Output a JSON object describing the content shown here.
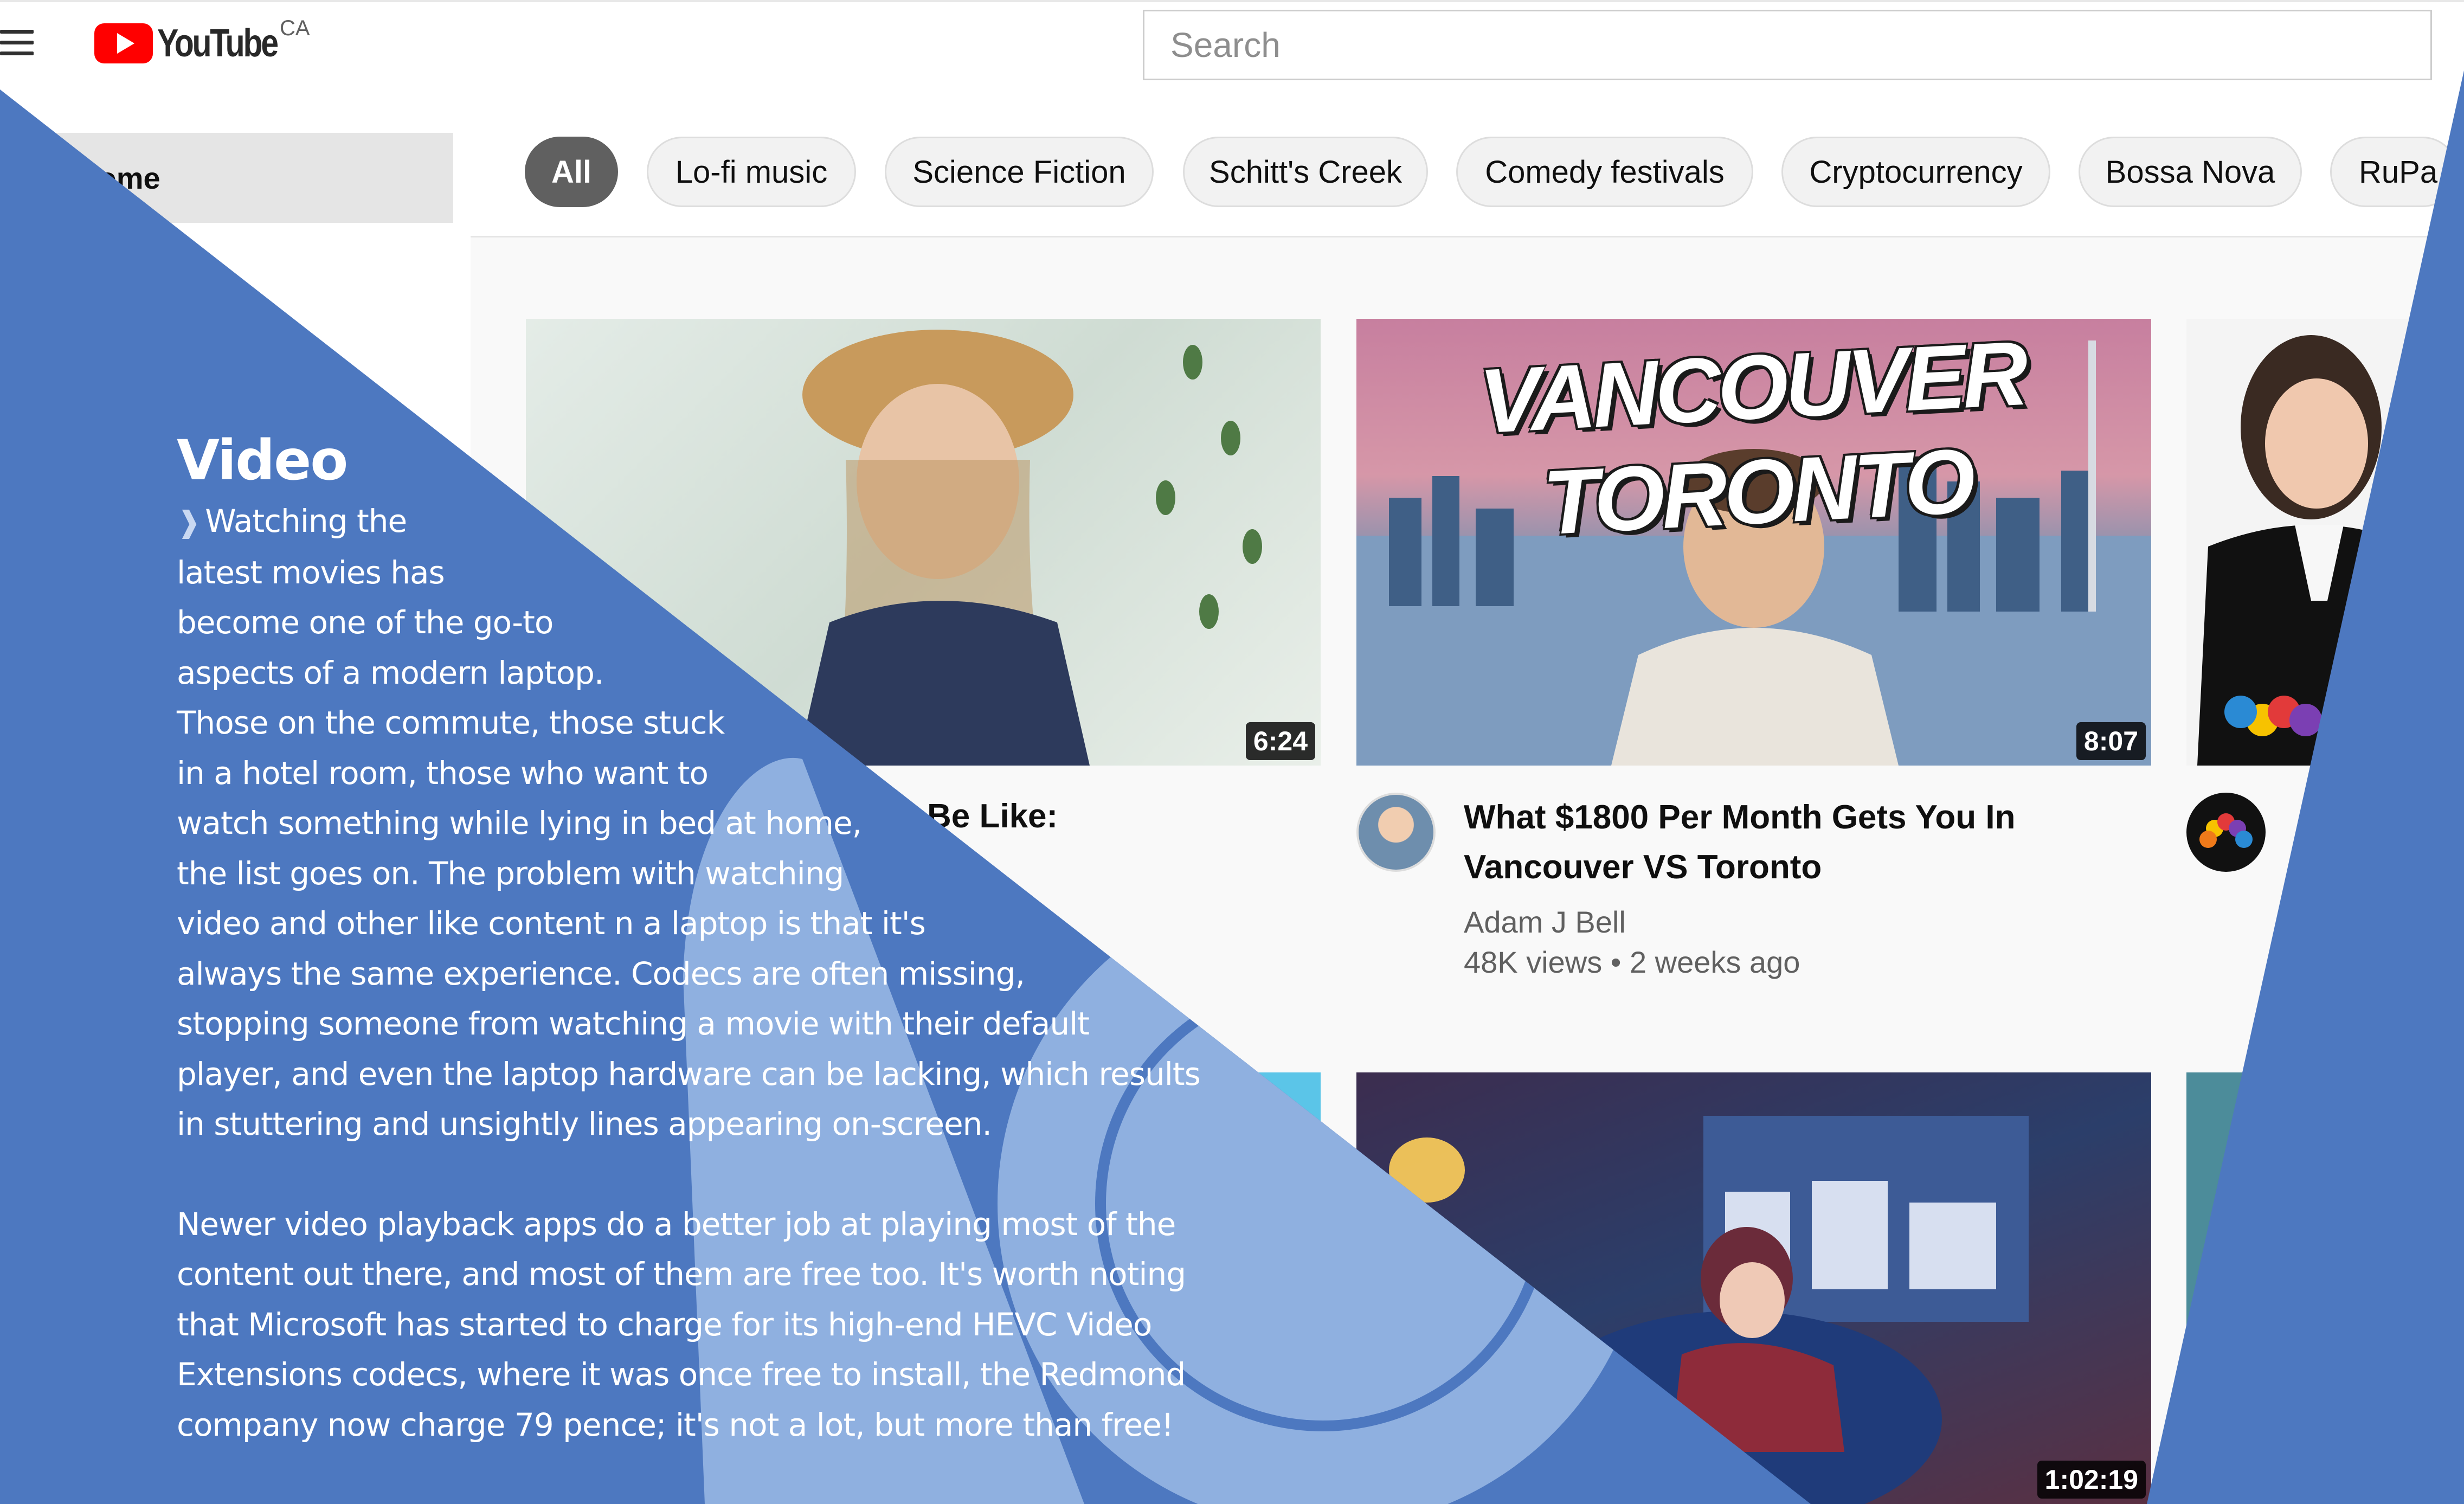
{
  "header": {
    "logo_text": "YouTube",
    "logo_region": "CA",
    "search_placeholder": "Search"
  },
  "sidebar": {
    "items": [
      {
        "label": "Home",
        "visible_label": "lome",
        "active": true
      }
    ]
  },
  "chips": [
    "All",
    "Lo-fi music",
    "Science Fiction",
    "Schitt's Creek",
    "Comedy festivals",
    "Cryptocurrency",
    "Bossa Nova",
    "RuPa"
  ],
  "videos": [
    {
      "duration": "6:24",
      "title_partial": "Be Like:"
    },
    {
      "duration": "8:07",
      "thumbnail_text": "VANCOUVER TORONTO",
      "title_lines": [
        "What $1800 Per Month Gets You In",
        "Vancouver VS Toronto"
      ],
      "channel": "Adam J Bell",
      "meta": "48K views • 2 weeks ago"
    },
    {
      "channel_avatar": "NBC"
    },
    {
      "duration": "1:02:19"
    }
  ],
  "article": {
    "heading": "Video",
    "para1_lines": [
      "Watching the",
      "latest movies has",
      "become one of the go-to",
      "aspects of a modern laptop.",
      "Those on the commute, those stuck",
      "in a hotel room, those who want to",
      "watch something while lying in bed at home,",
      "the list goes on. The problem with watching",
      "video and other like content n a laptop is that it's",
      "always the same experience. Codecs are often missing,",
      "stopping someone from watching a movie with their default",
      "player, and even the laptop hardware can be lacking, which results",
      "in stuttering and unsightly lines appearing on-screen."
    ],
    "para2_lines": [
      "Newer video playback apps do a better job at playing most of the",
      "content out there, and most of them are free too. It's worth noting",
      "that Microsoft has started to charge for its high-end HEVC Video",
      "Extensions codecs, where it was once free to install, the Redmond",
      "company now charge 79 pence; it's not a lot, but more than free!"
    ]
  },
  "colors": {
    "overlay_blue": "#4d78c0",
    "overlay_light_blue": "#8fb0e0",
    "youtube_red": "#ff0000"
  }
}
